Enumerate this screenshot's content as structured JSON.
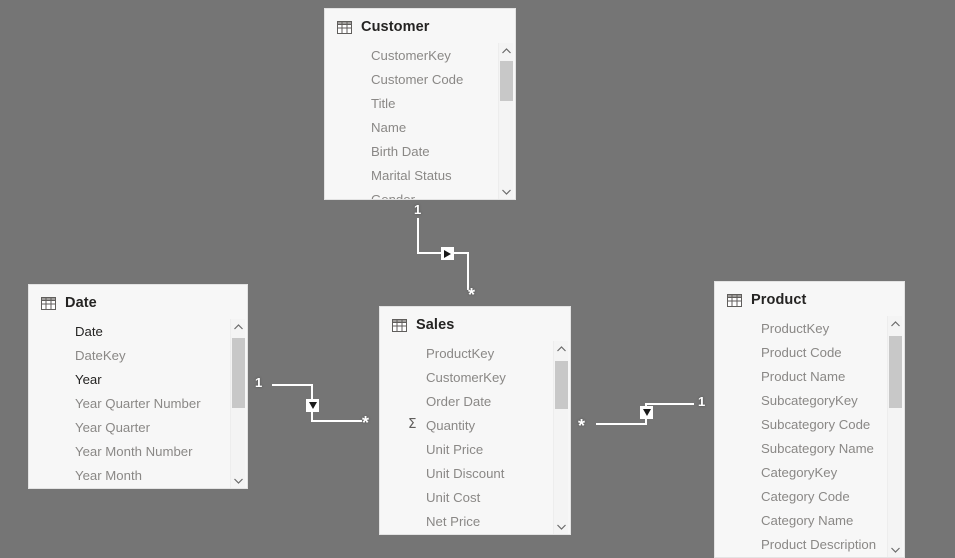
{
  "canvas": {
    "background_color": "#757575",
    "card_background_color": "#f7f7f7",
    "card_border_color": "#e3e3e3",
    "title_color": "#252423",
    "field_color": "#8a8886",
    "field_active_color": "#252423",
    "relationship_line_color": "#ffffff"
  },
  "tables": [
    {
      "name": "Customer",
      "icon": "table-icon",
      "fields": [
        {
          "label": "CustomerKey",
          "aggregated": false,
          "active": false
        },
        {
          "label": "Customer Code",
          "aggregated": false,
          "active": false
        },
        {
          "label": "Title",
          "aggregated": false,
          "active": false
        },
        {
          "label": "Name",
          "aggregated": false,
          "active": false
        },
        {
          "label": "Birth Date",
          "aggregated": false,
          "active": false
        },
        {
          "label": "Marital Status",
          "aggregated": false,
          "active": false
        },
        {
          "label": "Gender",
          "aggregated": false,
          "active": false
        }
      ]
    },
    {
      "name": "Date",
      "icon": "table-icon",
      "fields": [
        {
          "label": "Date",
          "aggregated": false,
          "active": true
        },
        {
          "label": "DateKey",
          "aggregated": false,
          "active": false
        },
        {
          "label": "Year",
          "aggregated": false,
          "active": true
        },
        {
          "label": "Year Quarter Number",
          "aggregated": false,
          "active": false
        },
        {
          "label": "Year Quarter",
          "aggregated": false,
          "active": false
        },
        {
          "label": "Year Month Number",
          "aggregated": false,
          "active": false
        },
        {
          "label": "Year Month",
          "aggregated": false,
          "active": false
        }
      ]
    },
    {
      "name": "Sales",
      "icon": "table-icon",
      "fields": [
        {
          "label": "ProductKey",
          "aggregated": false,
          "active": false
        },
        {
          "label": "CustomerKey",
          "aggregated": false,
          "active": false
        },
        {
          "label": "Order Date",
          "aggregated": false,
          "active": false
        },
        {
          "label": "Quantity",
          "aggregated": true,
          "active": false
        },
        {
          "label": "Unit Price",
          "aggregated": false,
          "active": false
        },
        {
          "label": "Unit Discount",
          "aggregated": false,
          "active": false
        },
        {
          "label": "Unit Cost",
          "aggregated": false,
          "active": false
        },
        {
          "label": "Net Price",
          "aggregated": false,
          "active": false
        }
      ]
    },
    {
      "name": "Product",
      "icon": "table-icon",
      "fields": [
        {
          "label": "ProductKey",
          "aggregated": false,
          "active": false
        },
        {
          "label": "Product Code",
          "aggregated": false,
          "active": false
        },
        {
          "label": "Product Name",
          "aggregated": false,
          "active": false
        },
        {
          "label": "SubcategoryKey",
          "aggregated": false,
          "active": false
        },
        {
          "label": "Subcategory Code",
          "aggregated": false,
          "active": false
        },
        {
          "label": "Subcategory Name",
          "aggregated": false,
          "active": false
        },
        {
          "label": "CategoryKey",
          "aggregated": false,
          "active": false
        },
        {
          "label": "Category Code",
          "aggregated": false,
          "active": false
        },
        {
          "label": "Category Name",
          "aggregated": false,
          "active": false
        },
        {
          "label": "Product Description",
          "aggregated": false,
          "active": false
        }
      ]
    }
  ],
  "relationships": [
    {
      "id": "customer-sales",
      "from_table": "Customer",
      "to_table": "Sales",
      "from_cardinality": "1",
      "to_cardinality": "*",
      "cross_filter_direction": "single-right"
    },
    {
      "id": "date-sales",
      "from_table": "Date",
      "to_table": "Sales",
      "from_cardinality": "1",
      "to_cardinality": "*",
      "cross_filter_direction": "single-down"
    },
    {
      "id": "product-sales",
      "from_table": "Product",
      "to_table": "Sales",
      "from_cardinality": "1",
      "to_cardinality": "*",
      "cross_filter_direction": "single-down"
    }
  ],
  "scrollbars": {
    "up_arrow_icon": "chevron-up-icon",
    "down_arrow_icon": "chevron-down-icon"
  }
}
